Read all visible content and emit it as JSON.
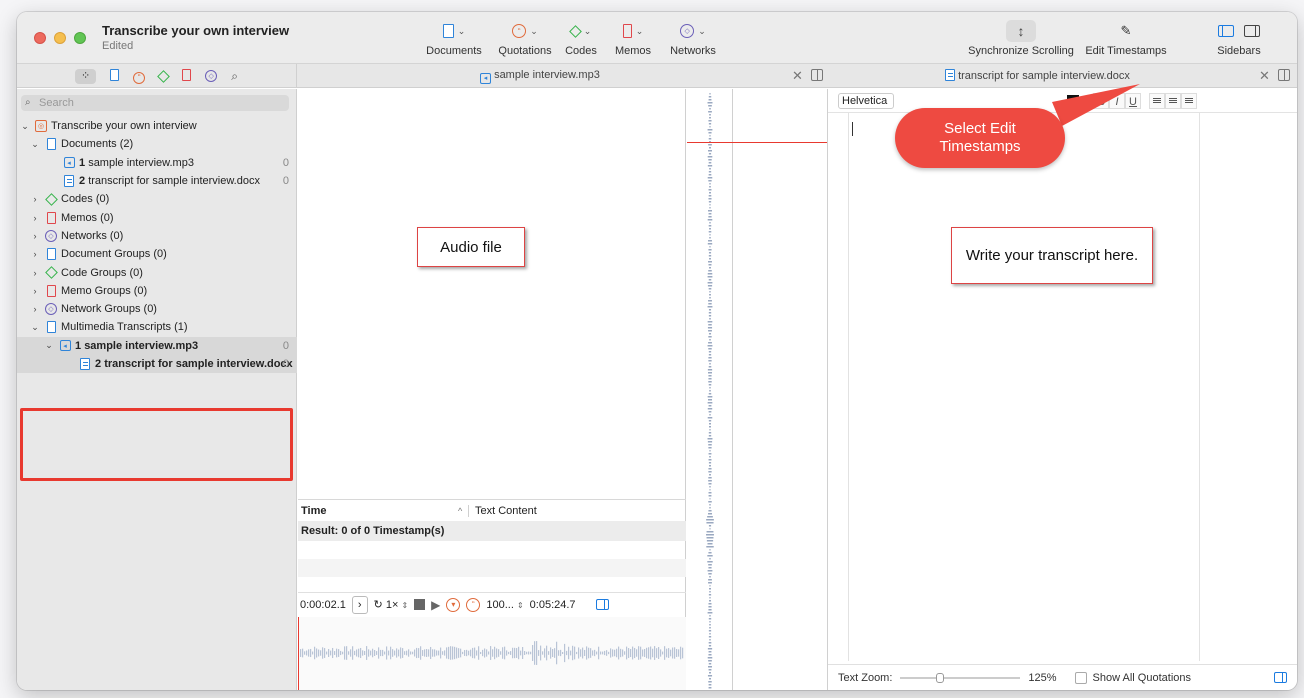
{
  "window": {
    "title": "Transcribe your own interview",
    "subtitle": "Edited"
  },
  "toolbar": {
    "documents": "Documents",
    "quotations": "Quotations",
    "codes": "Codes",
    "memos": "Memos",
    "networks": "Networks",
    "sync_scrolling": "Synchronize Scrolling",
    "edit_timestamps": "Edit Timestamps",
    "sidebars": "Sidebars"
  },
  "tabs": {
    "audio_tab": "sample interview.mp3",
    "transcript_tab": "transcript for sample interview.docx"
  },
  "sidebar": {
    "search_placeholder": "Search",
    "project": "Transcribe your own interview",
    "documents": "Documents (2)",
    "doc1_num": "1",
    "doc1_name": "sample interview.mp3",
    "doc1_count": "0",
    "doc2_num": "2",
    "doc2_name": "transcript for sample interview.docx",
    "doc2_count": "0",
    "codes": "Codes (0)",
    "memos": "Memos (0)",
    "networks": "Networks (0)",
    "document_groups": "Document Groups (0)",
    "code_groups": "Code Groups (0)",
    "memo_groups": "Memo Groups (0)",
    "network_groups": "Network Groups (0)",
    "multimedia_transcripts": "Multimedia Transcripts (1)",
    "mt_item1_num": "1",
    "mt_item1_name": "sample interview.mp3",
    "mt_item1_count": "0",
    "mt_item2_num": "2",
    "mt_item2_name": "transcript for sample interview.docx",
    "mt_item2_count": "0"
  },
  "annotations": {
    "audio_file": "Audio file",
    "write_transcript": "Write your transcript here.",
    "select_edit_timestamps": "Select Edit Timestamps"
  },
  "timestamps_table": {
    "col_time": "Time",
    "col_text": "Text Content",
    "result": "Result: 0 of 0 Timestamp(s)"
  },
  "player": {
    "current_time": "0:00:02.1",
    "speed": "1×",
    "volume": "100...",
    "duration": "0:05:24.7"
  },
  "editor": {
    "font": "Helvetica",
    "bold": "B",
    "italic": "I",
    "underline": "U"
  },
  "status": {
    "text_zoom_label": "Text Zoom:",
    "zoom_value": "125%",
    "show_all_quotations": "Show All Quotations"
  },
  "colors": {
    "accent": "#1b7be0",
    "highlight_red": "#e8392f",
    "bubble_red": "#ee4a41"
  }
}
